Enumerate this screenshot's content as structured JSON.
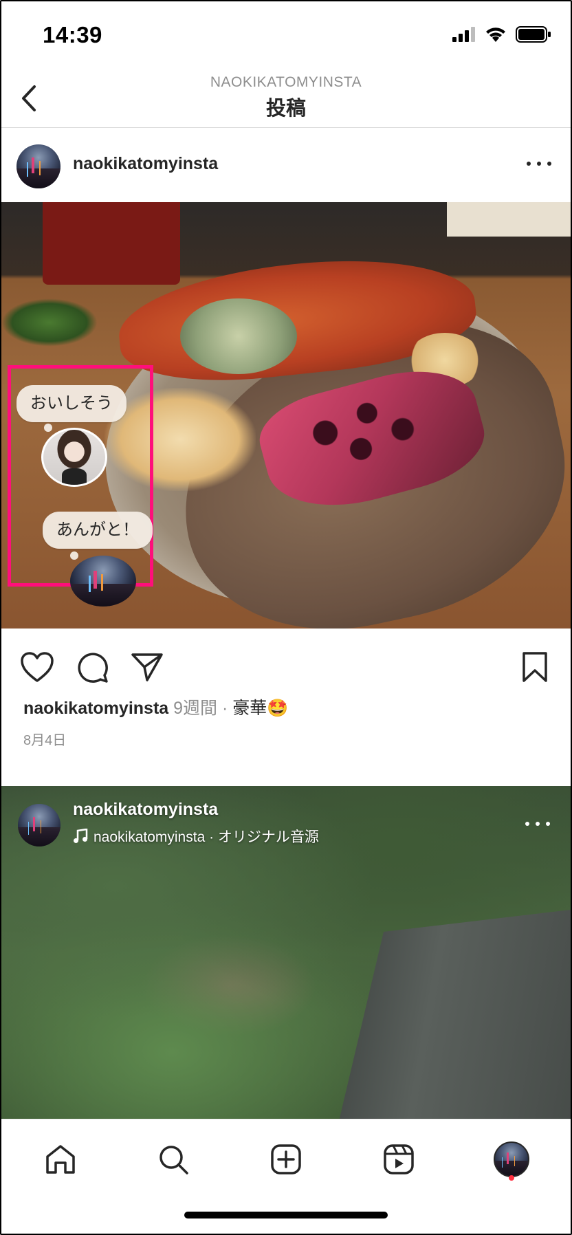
{
  "status_bar": {
    "time": "14:39"
  },
  "header": {
    "subtitle": "NAOKIKATOMYINSTA",
    "title": "投稿"
  },
  "post": {
    "username": "naokikatomyinsta",
    "comment_bubbles": [
      {
        "text": "おいしそう"
      },
      {
        "text": "あんがと！"
      }
    ],
    "caption": {
      "username": "naokikatomyinsta",
      "time": "9週間",
      "separator": "·",
      "text": "豪華🤩"
    },
    "date": "8月4日"
  },
  "post2": {
    "username": "naokikatomyinsta",
    "audio": "naokikatomyinsta · オリジナル音源"
  },
  "colors": {
    "highlight_border": "#ff0f7b",
    "notification_dot": "#ff3040"
  },
  "icons": [
    "back-icon",
    "more-icon",
    "heart-icon",
    "comment-icon",
    "share-icon",
    "bookmark-icon",
    "music-note-icon",
    "home-icon",
    "search-icon",
    "create-icon",
    "reels-icon",
    "profile-avatar"
  ]
}
